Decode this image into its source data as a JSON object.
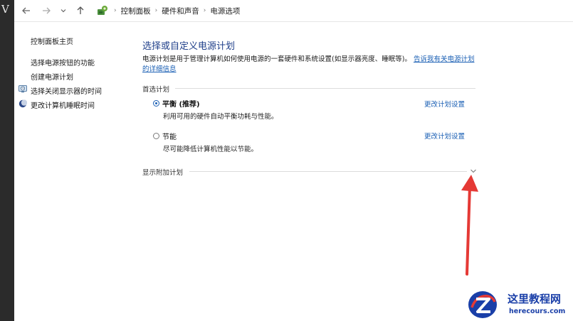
{
  "nav": {
    "breadcrumb": [
      "控制面板",
      "硬件和声音",
      "电源选项"
    ]
  },
  "sidebar": {
    "items": [
      {
        "label": "控制面板主页"
      },
      {
        "label": "选择电源按钮的功能"
      },
      {
        "label": "创建电源计划"
      },
      {
        "label": "选择关闭显示器的时间",
        "icon": "display-clock-icon"
      },
      {
        "label": "更改计算机睡眠时间",
        "icon": "moon-icon"
      }
    ]
  },
  "main": {
    "title": "选择或自定义电源计划",
    "description": "电源计划是用于管理计算机如何使用电源的一套硬件和系统设置(如显示器亮度、睡眠等)。",
    "description_link": "告诉我有关电源计划的详细信息",
    "preferred_heading": "首选计划",
    "plans": [
      {
        "name": "平衡 (推荐)",
        "desc": "利用可用的硬件自动平衡功耗与性能。",
        "link": "更改计划设置",
        "selected": true
      },
      {
        "name": "节能",
        "desc": "尽可能降低计算机性能以节能。",
        "link": "更改计划设置",
        "selected": false
      }
    ],
    "additional_heading": "显示附加计划"
  },
  "annotation": {
    "arrow_color": "#e53935"
  },
  "watermark": {
    "title": "这里教程网",
    "url": "herecours.com"
  },
  "colors": {
    "accent": "#1a5fb4",
    "title": "#1f3f8a",
    "watermark": "#1a3fa8"
  }
}
